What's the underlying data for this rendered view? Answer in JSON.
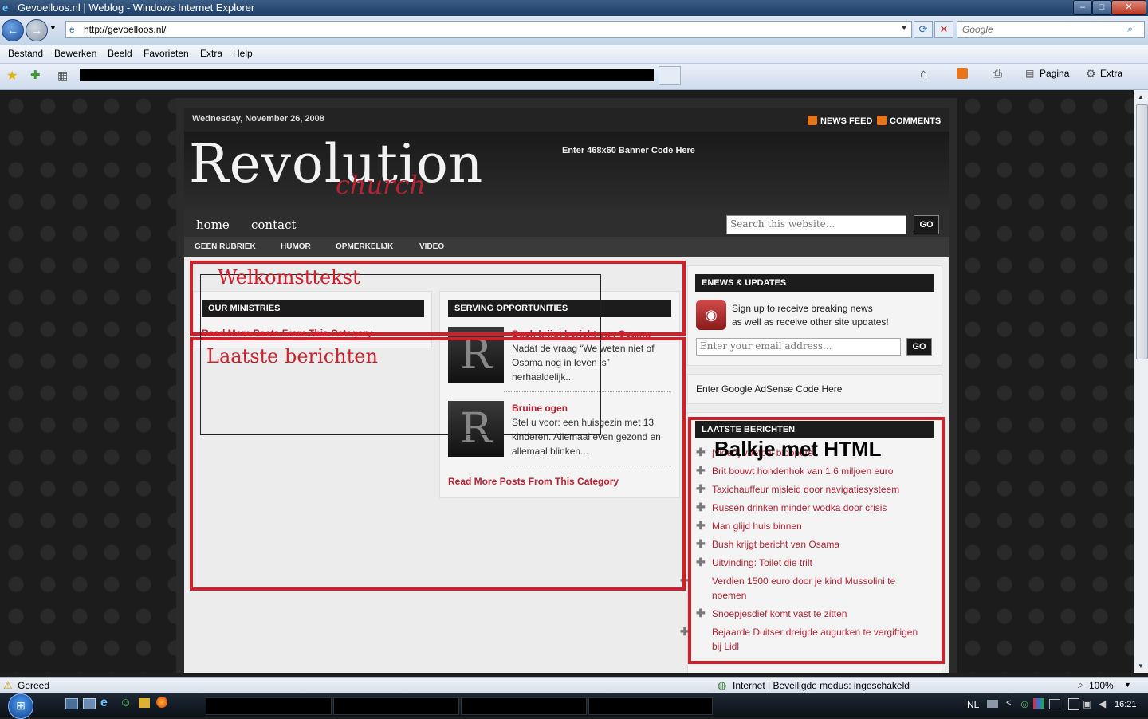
{
  "window": {
    "title": "Gevoelloos.nl | Weblog - Windows Internet Explorer",
    "minimize": "–",
    "maximize": "□",
    "close": "✕"
  },
  "browser": {
    "url": "http://gevoelloos.nl/",
    "search_placeholder": "Google",
    "menu": [
      "Bestand",
      "Bewerken",
      "Beeld",
      "Favorieten",
      "Extra",
      "Help"
    ],
    "commands": {
      "page": "Pagina",
      "tools": "Extra"
    },
    "status_left": "Gereed",
    "zone": "Internet | Beveiligde modus: ingeschakeld",
    "zoom": "100%"
  },
  "taskbar": {
    "language": "NL",
    "clock": "16:21"
  },
  "site": {
    "date": "Wednesday, November 26, 2008",
    "news_feed": "NEWS FEED",
    "comments": "COMMENTS",
    "logo_main": "Revolution",
    "logo_sub": "church",
    "banner": "Enter 468x60 Banner Code Here",
    "nav_primary": [
      "home",
      "contact"
    ],
    "search_placeholder": "Search this website...",
    "go": "GO",
    "nav_categories": [
      "GEEN RUBRIEK",
      "HUMOR",
      "OPMERKELIJK",
      "VIDEO"
    ]
  },
  "annotations": {
    "welcome": "Welkomsttekst",
    "latest": "Laatste berichten",
    "html_bar": "Balkje met HTML"
  },
  "content": {
    "ministries": {
      "heading": "OUR MINISTRIES",
      "more": "Read More Posts From This Category"
    },
    "serving": {
      "heading": "SERVING OPPORTUNITIES",
      "thumb_letter": "R",
      "posts": [
        {
          "title": "Bush krijgt bericht van Osama",
          "excerpt": "Nadat de vraag “We weten niet of Osama nog in leven is” herhaaldelijk..."
        },
        {
          "title": "Bruine ogen",
          "excerpt": "Stel u voor: een huisgezin met 13 kinderen. Allemaal even gezond en allemaal blinken..."
        }
      ],
      "more": "Read More Posts From This Category"
    }
  },
  "sidebar": {
    "enews": {
      "heading": "ENEWS & UPDATES",
      "line1": "Sign up to receive breaking news",
      "line2": "as well as receive other site updates!",
      "email_placeholder": "Enter your email address...",
      "go": "GO"
    },
    "adsense": "Enter Google AdSense Code Here",
    "latest": {
      "heading": "LAATSTE BERICHTEN",
      "items": [
        "[video] voetbal bloopers",
        "Brit bouwt hondenhok van 1,6 miljoen euro",
        "Taxichauffeur misleid door navigatiesysteem",
        "Russen drinken minder wodka door crisis",
        "Man glijd huis binnen",
        "Bush krijgt bericht van Osama",
        "Uitvinding: Toilet die trilt",
        "Verdien 1500 euro door je kind Mussolini te noemen",
        "Snoepjesdief komt vast te zitten",
        "Bejaarde Duitser dreigde augurken te vergiftigen bij Lidl"
      ]
    }
  }
}
